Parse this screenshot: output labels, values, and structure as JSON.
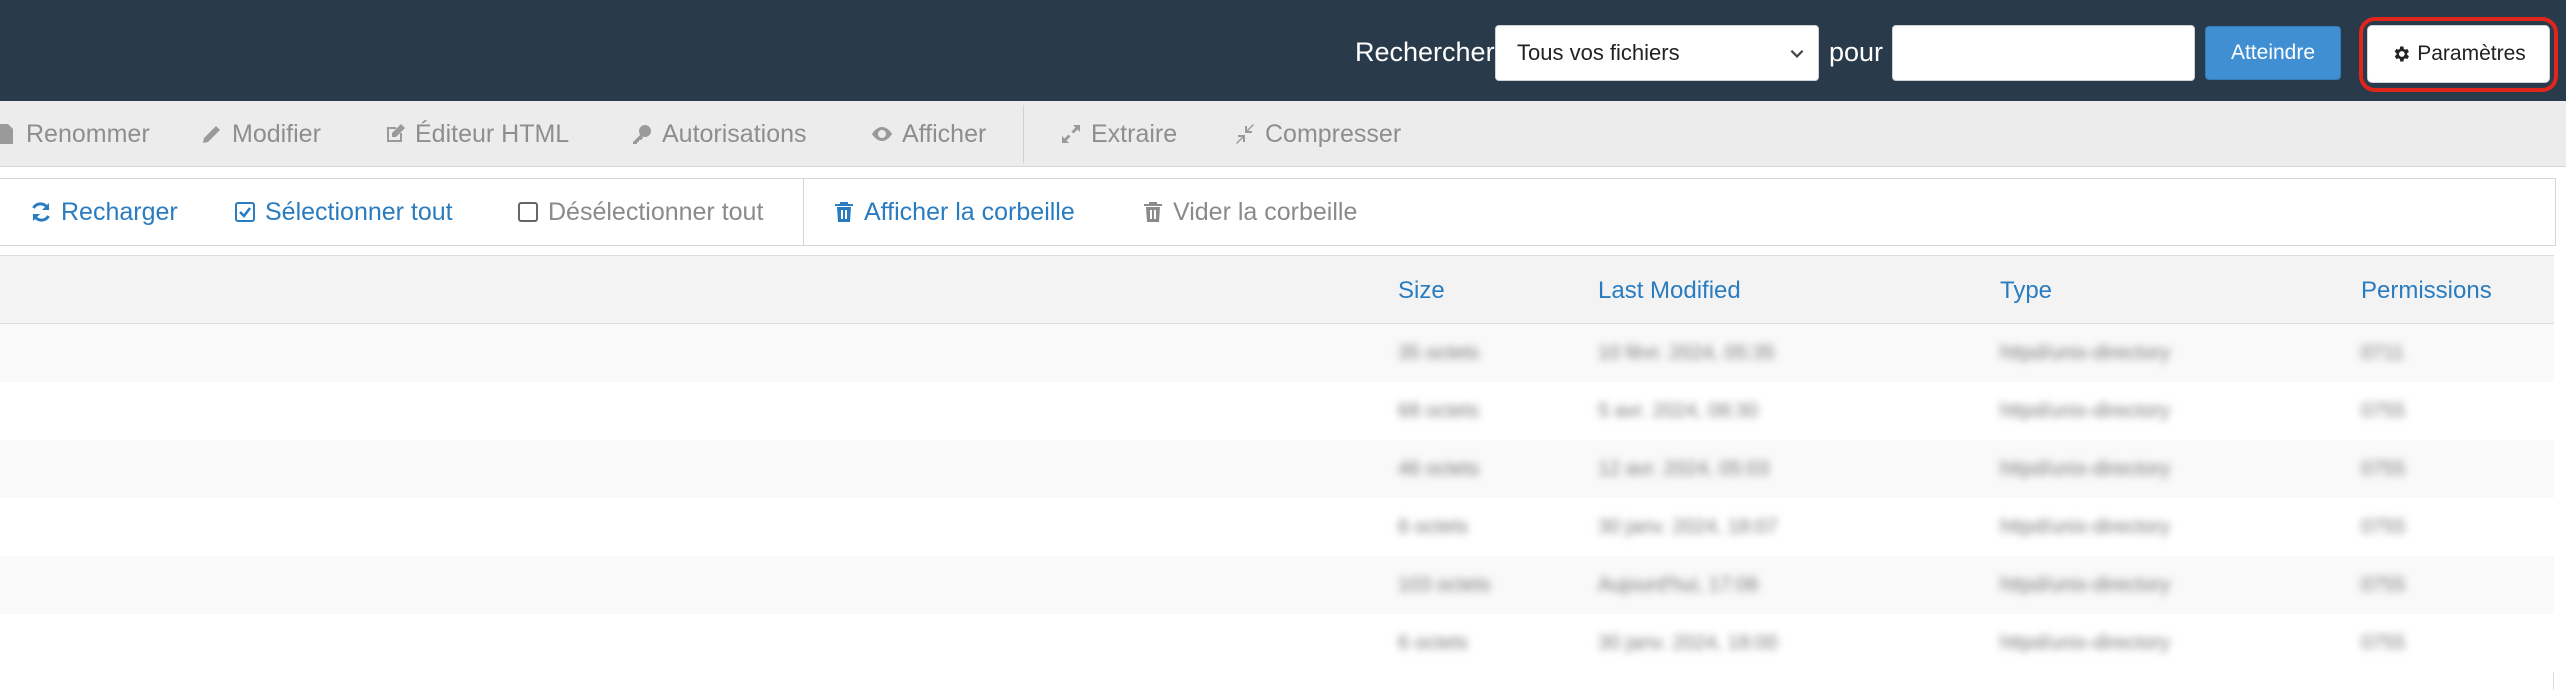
{
  "header": {
    "search_label": "Rechercher",
    "scope_select_value": "Tous vos fichiers",
    "for_label": "pour",
    "search_input_value": "",
    "go_label": "Atteindre",
    "settings_label": "Paramètres",
    "highlight_color": "#e0251b"
  },
  "toolbar": {
    "rename": "Renommer",
    "edit": "Modifier",
    "html_editor": "Éditeur HTML",
    "permissions": "Autorisations",
    "view": "Afficher",
    "extract": "Extraire",
    "compress": "Compresser"
  },
  "toolbar2": {
    "reload": "Recharger",
    "select_all": "Sélectionner tout",
    "deselect_all": "Désélectionner tout",
    "show_trash": "Afficher la corbeille",
    "empty_trash": "Vider la corbeille"
  },
  "table": {
    "columns": [
      "Size",
      "Last Modified",
      "Type",
      "Permissions"
    ],
    "rows": [
      [
        "35 octets",
        "10 févr. 2024, 05:35",
        "httpd/unix-directory",
        "0711"
      ],
      [
        "68 octets",
        "5 avr. 2024, 08:30",
        "httpd/unix-directory",
        "0755"
      ],
      [
        "46 octets",
        "12 avr. 2024, 05:03",
        "httpd/unix-directory",
        "0755"
      ],
      [
        "6 octets",
        "30 janv. 2024, 18:07",
        "httpd/unix-directory",
        "0755"
      ],
      [
        "103 octets",
        "Aujourd'hui, 17:06",
        "httpd/unix-directory",
        "0755"
      ],
      [
        "6 octets",
        "30 janv. 2024, 18:00",
        "httpd/unix-directory",
        "0755"
      ]
    ]
  }
}
